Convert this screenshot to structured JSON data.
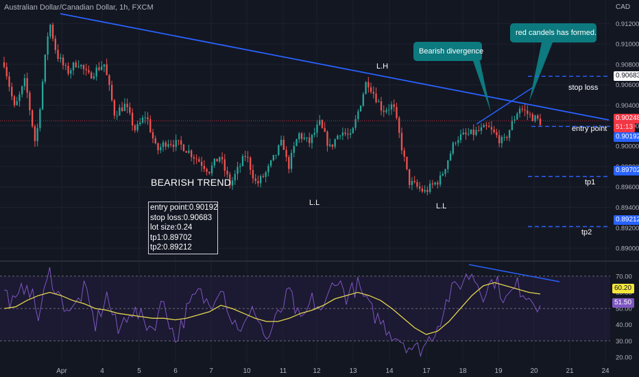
{
  "header": {
    "title": "Australian Dollar/Canadian Dollar, 1h, FXCM",
    "currency": "CAD"
  },
  "colors": {
    "background": "#131722",
    "up_candle": "#26a69a",
    "down_candle": "#ef5350",
    "trendline": "#2962ff",
    "level_line": "#2962ff",
    "callout_bg": "#0d7a7f",
    "rsi_line": "#7e57c2",
    "rsi_ma_line": "#e6d84e",
    "rsi_band": "#1f1a35"
  },
  "chart_data": [
    {
      "type": "candlestick",
      "title": "Australian Dollar/Canadian Dollar, 1h, FXCM",
      "x_ticks": [
        "Apr",
        "4",
        "5",
        "6",
        "7",
        "10",
        "11",
        "12",
        "13",
        "14",
        "17",
        "18",
        "19",
        "20",
        "21",
        "24"
      ],
      "y_ticks": [
        "0.91200",
        "0.91000",
        "0.90800",
        "0.90600",
        "0.90400",
        "0.90200",
        "0.90000",
        "0.89800",
        "0.89600",
        "0.89400",
        "0.89200",
        "0.89000"
      ],
      "ylim": [
        0.8892,
        0.9139
      ],
      "grid": true,
      "pivots": [
        {
          "x": 0.0,
          "y": 0.9082
        },
        {
          "x": 1.0,
          "y": 0.9036
        },
        {
          "x": 2.0,
          "y": 0.9064
        },
        {
          "x": 3.0,
          "y": 0.9001
        },
        {
          "x": 4.3,
          "y": 0.9123
        },
        {
          "x": 5.0,
          "y": 0.909
        },
        {
          "x": 6.0,
          "y": 0.9072
        },
        {
          "x": 7.0,
          "y": 0.9083
        },
        {
          "x": 8.0,
          "y": 0.9068
        },
        {
          "x": 9.5,
          "y": 0.9081
        },
        {
          "x": 10.5,
          "y": 0.9032
        },
        {
          "x": 11.5,
          "y": 0.904
        },
        {
          "x": 12.5,
          "y": 0.9015
        },
        {
          "x": 13.5,
          "y": 0.9031
        },
        {
          "x": 14.5,
          "y": 0.8995
        },
        {
          "x": 15.5,
          "y": 0.9005
        },
        {
          "x": 17.0,
          "y": 0.9
        },
        {
          "x": 18.5,
          "y": 0.8986
        },
        {
          "x": 19.5,
          "y": 0.8976
        },
        {
          "x": 20.5,
          "y": 0.899
        },
        {
          "x": 21.5,
          "y": 0.8962
        },
        {
          "x": 23.0,
          "y": 0.8992
        },
        {
          "x": 24.0,
          "y": 0.8962
        },
        {
          "x": 25.0,
          "y": 0.8975
        },
        {
          "x": 26.5,
          "y": 0.9005
        },
        {
          "x": 27.0,
          "y": 0.8978
        },
        {
          "x": 28.0,
          "y": 0.9012
        },
        {
          "x": 29.0,
          "y": 0.9003
        },
        {
          "x": 30.0,
          "y": 0.9022
        },
        {
          "x": 31.0,
          "y": 0.8998
        },
        {
          "x": 32.0,
          "y": 0.9015
        },
        {
          "x": 33.0,
          "y": 0.9008
        },
        {
          "x": 34.5,
          "y": 0.9065
        },
        {
          "x": 36.0,
          "y": 0.9035
        },
        {
          "x": 37.0,
          "y": 0.904
        },
        {
          "x": 38.5,
          "y": 0.8965
        },
        {
          "x": 40.0,
          "y": 0.8955
        },
        {
          "x": 41.5,
          "y": 0.8968
        },
        {
          "x": 43.0,
          "y": 0.9008
        },
        {
          "x": 44.5,
          "y": 0.9012
        },
        {
          "x": 46.0,
          "y": 0.9018
        },
        {
          "x": 47.5,
          "y": 0.9003
        },
        {
          "x": 49.0,
          "y": 0.9038
        },
        {
          "x": 50.0,
          "y": 0.903
        },
        {
          "x": 51.0,
          "y": 0.9024
        }
      ],
      "annotations": [
        {
          "text": "BEARISH TREND"
        },
        {
          "text": "L.H"
        },
        {
          "text": "L.L"
        },
        {
          "text": "L.L"
        },
        {
          "text": "Bearish divergence"
        },
        {
          "text": "red candels has formed."
        },
        {
          "text": "stop loss"
        },
        {
          "text": "entry point"
        },
        {
          "text": "tp1"
        },
        {
          "text": "tp2"
        }
      ],
      "levels": [
        {
          "name": "stop loss",
          "value": 0.90683,
          "color": "#2962ff"
        },
        {
          "name": "entry point",
          "value": 0.90192,
          "color": "#2962ff"
        },
        {
          "name": "tp1",
          "value": 0.89702,
          "color": "#2962ff"
        },
        {
          "name": "tp2",
          "value": 0.89212,
          "color": "#2962ff"
        }
      ],
      "current_price": 0.90248,
      "countdown": "51:13"
    },
    {
      "type": "line",
      "title": "",
      "y_ticks": [
        "70.00",
        "60.00",
        "50.00",
        "40.00",
        "30.00",
        "20.00"
      ],
      "ylim": [
        17,
        78
      ],
      "bands": [
        30,
        50,
        70
      ],
      "series": [
        {
          "values": [
            60,
            52,
            68,
            45,
            72,
            55,
            48,
            62,
            40,
            58,
            35,
            50,
            44,
            38,
            55,
            30,
            48,
            60,
            52,
            66,
            42,
            38,
            50,
            30,
            45,
            60,
            40,
            55,
            48,
            70,
            58,
            64,
            50,
            42,
            35,
            30,
            24,
            28,
            40,
            58,
            66,
            72,
            60,
            68,
            55,
            64,
            58,
            52
          ]
        },
        {
          "values": [
            50,
            51,
            55,
            58,
            60,
            58,
            55,
            53,
            50,
            49,
            47,
            46,
            45,
            44,
            44,
            43,
            44,
            46,
            48,
            52,
            50,
            47,
            44,
            42,
            42,
            44,
            47,
            49,
            52,
            56,
            58,
            60,
            58,
            55,
            50,
            44,
            38,
            34,
            36,
            42,
            50,
            58,
            64,
            66,
            64,
            62,
            60,
            59
          ]
        }
      ],
      "current_values": {
        "rsi": "51.50",
        "ma": "60.20"
      }
    }
  ],
  "info_box": {
    "entry": "entry point:0.90192",
    "stop": "stop loss:0.90683",
    "lot": "lot size:0.24",
    "tp1": "tp1:0.89702",
    "tp2": "tp2:0.89212"
  },
  "labels": {
    "trend": "BEARISH TREND",
    "lh": "L.H",
    "ll1": "L.L",
    "ll2": "L.L",
    "divergence": "Bearish divergence",
    "red_candles": "red candels has formed.",
    "stop_loss": "stop loss",
    "entry_point": "entry point",
    "tp1": "tp1",
    "tp2": "tp2"
  },
  "price_tags": {
    "stop": "0.90683",
    "current": "0.90248",
    "countdown": "51:13",
    "entry": "0.90192",
    "tp1": "0.89702",
    "tp2": "0.89212"
  }
}
